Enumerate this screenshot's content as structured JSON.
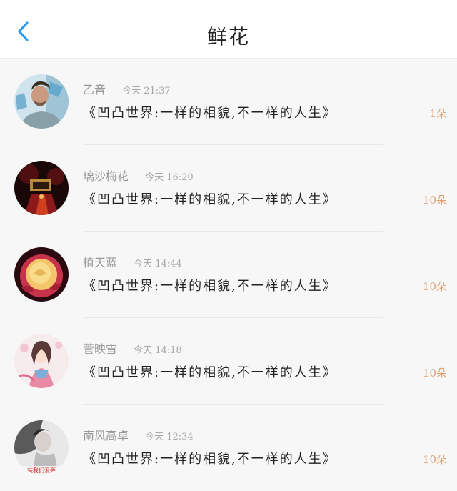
{
  "header": {
    "title": "鲜花",
    "back_icon": "chevron-left-icon",
    "accent_color": "#2d9cf0"
  },
  "items": [
    {
      "name": "乙音",
      "time": "今天 21:37",
      "message": "《凹凸世界:一样的相貌,不一样的人生》",
      "count": "1朵"
    },
    {
      "name": "璃沙梅花",
      "time": "今天 16:20",
      "message": "《凹凸世界:一样的相貌,不一样的人生》",
      "count": "10朵"
    },
    {
      "name": "植天蓝",
      "time": "今天 14:44",
      "message": "《凹凸世界:一样的相貌,不一样的人生》",
      "count": "10朵"
    },
    {
      "name": "菅映雪",
      "time": "今天 14:18",
      "message": "《凹凸世界:一样的相貌,不一样的人生》",
      "count": "10朵"
    },
    {
      "name": "南风高卓",
      "time": "今天 12:34",
      "message": "《凹凸世界:一样的相貌,不一样的人生》",
      "count": "10朵"
    }
  ],
  "avatar_caption": "装我们没要"
}
